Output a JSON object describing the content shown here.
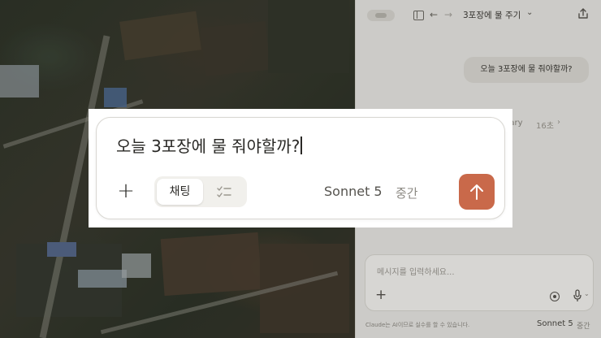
{
  "app": {
    "title": "3포장에 물 주기",
    "title_chevron": "⌄",
    "back_icon": "←",
    "forward_icon": "→"
  },
  "conversation": {
    "user_message": "오늘 3포장에 물 줘야할까?",
    "summary_label": "nary",
    "summary_time": "16초",
    "summary_chevron": "›"
  },
  "small_composer": {
    "placeholder": "메시지를 입력하세요...",
    "plus": "+",
    "disclaimer": "Claude는 AI이므로 실수를 할 수 있습니다.",
    "model": "Sonnet 5",
    "effort": "중간",
    "mic_chevron": "⌄"
  },
  "zoom_composer": {
    "prompt": "오늘 3포장에 물 줘야할까?",
    "plus": "+",
    "mode_chat": "채팅",
    "model": "Sonnet 5",
    "effort": "중간"
  },
  "colors": {
    "send_button": "#c9694a",
    "panel_bg": "#e9e8e4"
  },
  "icons": [
    "sidebar-icon",
    "back-icon",
    "forward-icon",
    "share-icon",
    "plus-icon",
    "record-icon",
    "mic-icon",
    "tasks-icon",
    "arrow-up-icon"
  ]
}
